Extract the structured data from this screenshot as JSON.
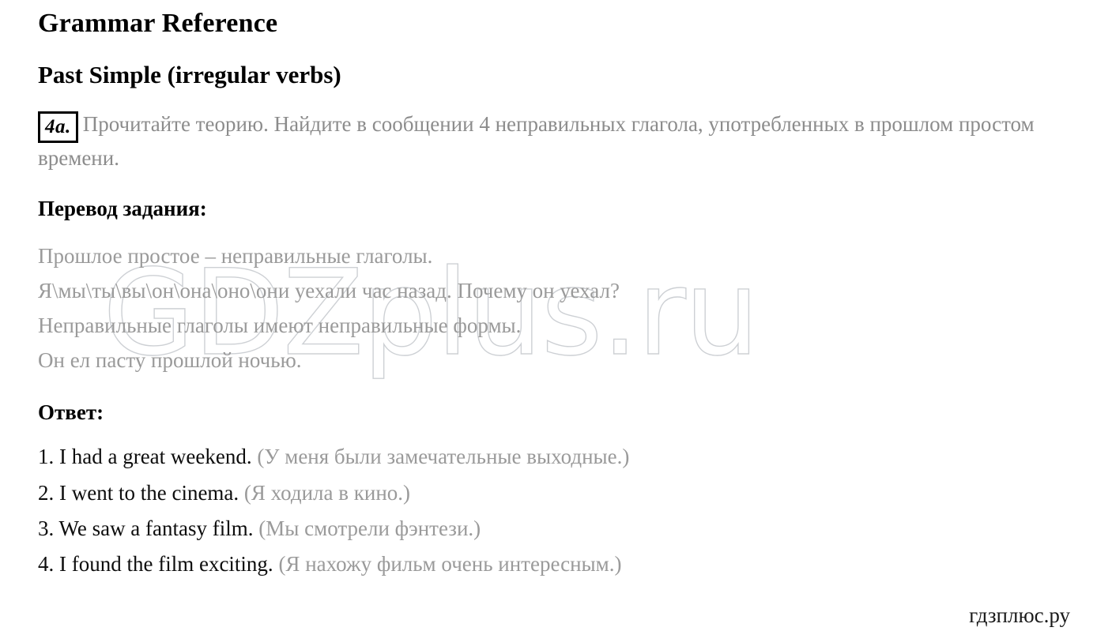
{
  "document": {
    "title": "Grammar Reference",
    "section_title": "Past Simple (irregular verbs)"
  },
  "task": {
    "badge": "4a.",
    "instruction": "Прочитайте теорию. Найдите в сообщении 4 неправильных глагола, употребленных в прошлом простом времени."
  },
  "translation_section": {
    "heading": "Перевод задания:",
    "lines": [
      "Прошлое простое – неправильные глаголы.",
      "Я\\мы\\ты\\вы\\он\\она\\оно\\они уехали час назад. Почему он уехал?",
      "Неправильные глаголы имеют неправильные формы.",
      "Он ел пасту прошлой ночью."
    ]
  },
  "answer_section": {
    "heading": "Ответ:",
    "items": [
      {
        "number": "1.",
        "english": "I had a great weekend.",
        "russian": "(У меня были замечательные выходные.)"
      },
      {
        "number": "2.",
        "english": "I went to the cinema.",
        "russian": "(Я ходила в кино.)"
      },
      {
        "number": "3.",
        "english": "We saw a fantasy film.",
        "russian": "(Мы смотрели фэнтези.)"
      },
      {
        "number": "4.",
        "english": "I found the film exciting.",
        "russian": "(Я нахожу фильм очень интересным.)"
      }
    ]
  },
  "watermark": {
    "text": "GDZplus.ru",
    "color": "#cdd0d4"
  },
  "footer": {
    "brand": "гдзплюс.ру"
  }
}
